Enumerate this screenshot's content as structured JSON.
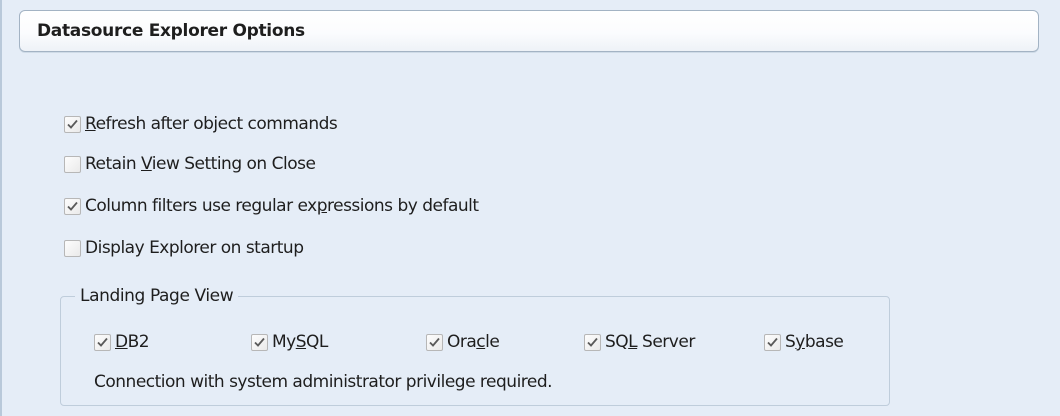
{
  "header": {
    "title": "Datasource Explorer Options"
  },
  "options": [
    {
      "pre": "",
      "mnemonic": "R",
      "post": "efresh after object commands",
      "checked": true
    },
    {
      "pre": "Retain ",
      "mnemonic": "V",
      "post": "iew Setting on Close",
      "checked": false
    },
    {
      "pre": "Column filters use regular ex",
      "mnemonic": "p",
      "post": "ressions by default",
      "checked": true
    },
    {
      "pre": "Display Explorer on startup",
      "mnemonic": "",
      "post": "",
      "checked": false
    }
  ],
  "landing_page": {
    "legend": "Landing Page View",
    "items": [
      {
        "pre": "",
        "mnemonic": "D",
        "post": "B2",
        "checked": true
      },
      {
        "pre": "My",
        "mnemonic": "S",
        "post": "QL",
        "checked": true
      },
      {
        "pre": "Ora",
        "mnemonic": "c",
        "post": "le",
        "checked": true
      },
      {
        "pre": "SQ",
        "mnemonic": "L",
        "post": " Server",
        "checked": true
      },
      {
        "pre": "S",
        "mnemonic": "y",
        "post": "base",
        "checked": true
      }
    ],
    "note": "Connection with system administrator privilege required."
  },
  "colors": {
    "panel_bg": "#e5edf7",
    "checkmark": "#5a5a5a",
    "group_border": "#bfcddb"
  }
}
